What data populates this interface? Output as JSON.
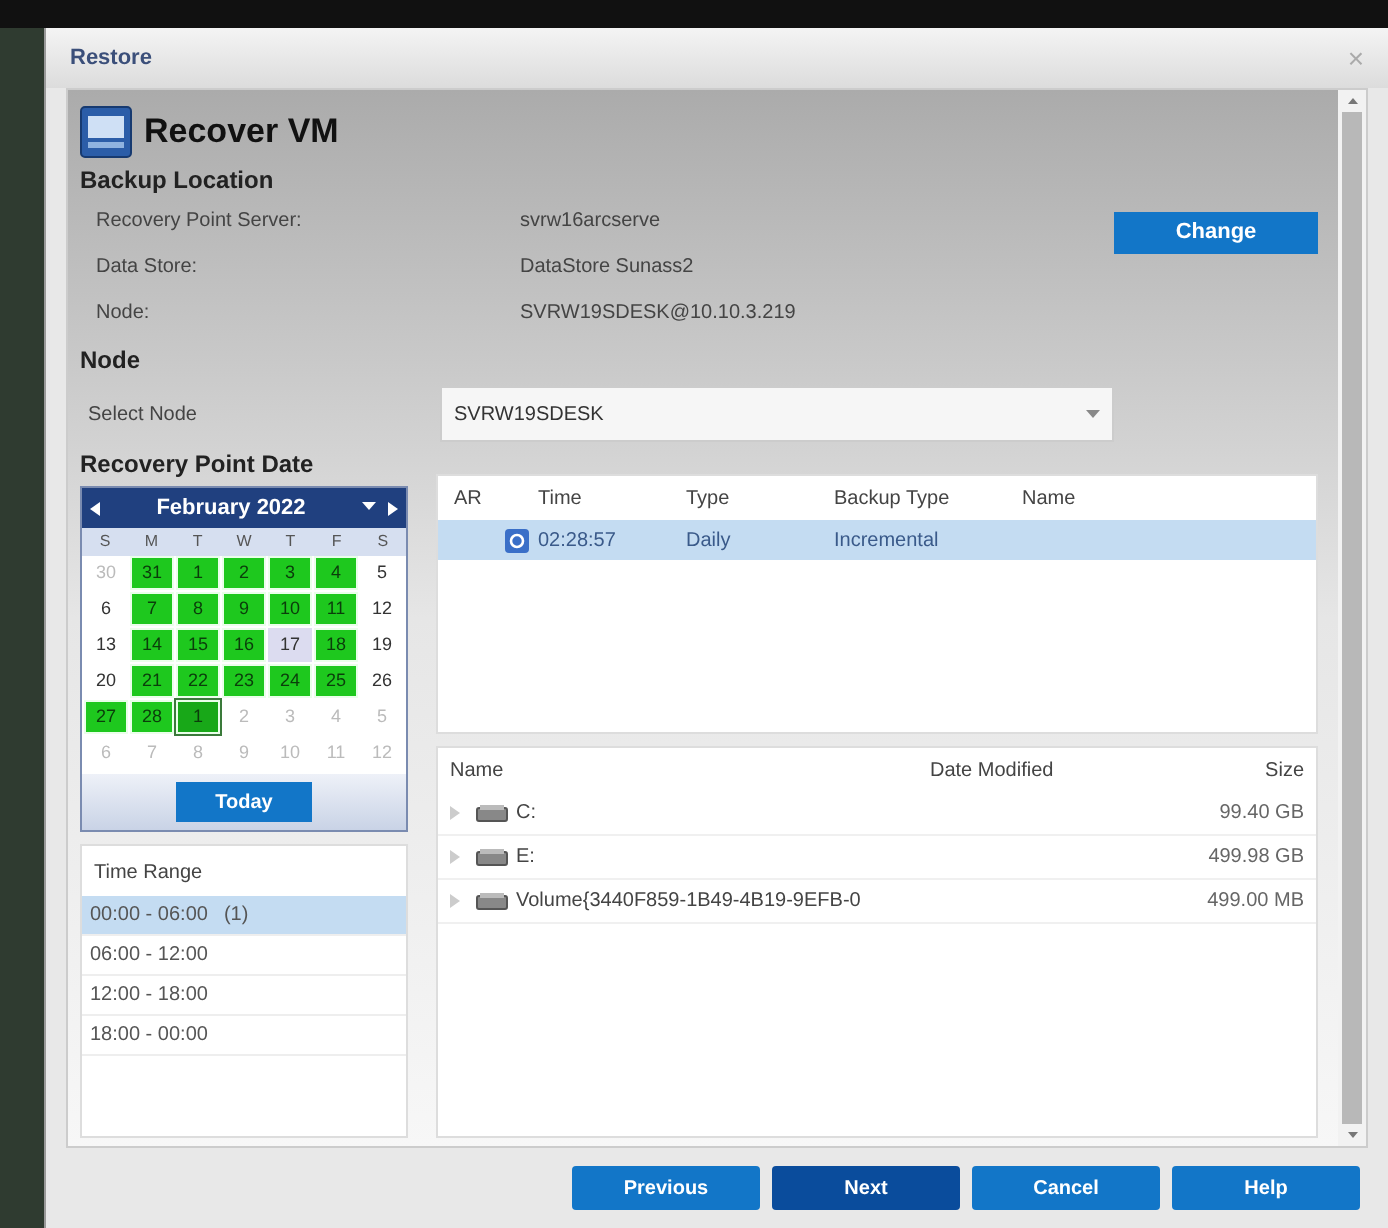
{
  "window": {
    "title": "Restore",
    "close": "×"
  },
  "header": {
    "title": "Recover VM"
  },
  "backup_location": {
    "heading": "Backup Location",
    "fields": [
      {
        "label": "Recovery Point Server:",
        "value": "svrw16arcserve"
      },
      {
        "label": "Data Store:",
        "value": "DataStore Sunass2"
      },
      {
        "label": "Node:",
        "value": "SVRW19SDESK@10.10.3.219"
      }
    ],
    "change_button": "Change"
  },
  "node": {
    "heading": "Node",
    "label": "Select Node",
    "value": "SVRW19SDESK"
  },
  "calendar": {
    "heading": "Recovery Point Date",
    "month": "February 2022",
    "weekdays": [
      "S",
      "M",
      "T",
      "W",
      "T",
      "F",
      "S"
    ],
    "weeks": [
      [
        {
          "label": "30",
          "kind": "other",
          "selected": false
        },
        {
          "label": "31",
          "kind": "backup",
          "selected": false
        },
        {
          "label": "1",
          "kind": "backup",
          "selected": false
        },
        {
          "label": "2",
          "kind": "backup",
          "selected": false
        },
        {
          "label": "3",
          "kind": "backup",
          "selected": false
        },
        {
          "label": "4",
          "kind": "backup",
          "selected": false
        },
        {
          "label": "5",
          "kind": "plain",
          "selected": false
        }
      ],
      [
        {
          "label": "6",
          "kind": "plain",
          "selected": false
        },
        {
          "label": "7",
          "kind": "backup",
          "selected": false
        },
        {
          "label": "8",
          "kind": "backup",
          "selected": false
        },
        {
          "label": "9",
          "kind": "backup",
          "selected": false
        },
        {
          "label": "10",
          "kind": "backup",
          "selected": false
        },
        {
          "label": "11",
          "kind": "backup",
          "selected": false
        },
        {
          "label": "12",
          "kind": "plain",
          "selected": false
        }
      ],
      [
        {
          "label": "13",
          "kind": "plain",
          "selected": false
        },
        {
          "label": "14",
          "kind": "backup",
          "selected": false
        },
        {
          "label": "15",
          "kind": "backup",
          "selected": false
        },
        {
          "label": "16",
          "kind": "backup",
          "selected": false
        },
        {
          "label": "17",
          "kind": "today",
          "selected": false
        },
        {
          "label": "18",
          "kind": "backup",
          "selected": false
        },
        {
          "label": "19",
          "kind": "plain",
          "selected": false
        }
      ],
      [
        {
          "label": "20",
          "kind": "plain",
          "selected": false
        },
        {
          "label": "21",
          "kind": "backup",
          "selected": false
        },
        {
          "label": "22",
          "kind": "backup",
          "selected": false
        },
        {
          "label": "23",
          "kind": "backup",
          "selected": false
        },
        {
          "label": "24",
          "kind": "backup",
          "selected": false
        },
        {
          "label": "25",
          "kind": "backup",
          "selected": false
        },
        {
          "label": "26",
          "kind": "plain",
          "selected": false
        }
      ],
      [
        {
          "label": "27",
          "kind": "backup",
          "selected": false
        },
        {
          "label": "28",
          "kind": "backup",
          "selected": false
        },
        {
          "label": "1",
          "kind": "backup",
          "selected": true
        },
        {
          "label": "2",
          "kind": "other",
          "selected": false
        },
        {
          "label": "3",
          "kind": "other",
          "selected": false
        },
        {
          "label": "4",
          "kind": "other",
          "selected": false
        },
        {
          "label": "5",
          "kind": "other",
          "selected": false
        }
      ],
      [
        {
          "label": "6",
          "kind": "other",
          "selected": false
        },
        {
          "label": "7",
          "kind": "other",
          "selected": false
        },
        {
          "label": "8",
          "kind": "other",
          "selected": false
        },
        {
          "label": "9",
          "kind": "other",
          "selected": false
        },
        {
          "label": "10",
          "kind": "other",
          "selected": false
        },
        {
          "label": "11",
          "kind": "other",
          "selected": false
        },
        {
          "label": "12",
          "kind": "other",
          "selected": false
        }
      ]
    ],
    "today_button": "Today"
  },
  "time_range": {
    "heading": "Time Range",
    "items": [
      {
        "label": "00:00 - 06:00",
        "count": "(1)",
        "selected": true
      },
      {
        "label": "06:00 - 12:00",
        "selected": false
      },
      {
        "label": "12:00 - 18:00",
        "selected": false
      },
      {
        "label": "18:00 - 00:00",
        "selected": false
      }
    ]
  },
  "recovery_points": {
    "columns": [
      "AR",
      "Time",
      "Type",
      "Backup Type",
      "Name"
    ],
    "rows": [
      {
        "time": "02:28:57",
        "type": "Daily",
        "backup_type": "Incremental",
        "selected": true
      }
    ]
  },
  "files": {
    "columns": [
      "Name",
      "Date Modified",
      "Size"
    ],
    "rows": [
      {
        "name": "C:",
        "size": "99.40 GB"
      },
      {
        "name": "E:",
        "size": "499.98 GB"
      },
      {
        "name": "Volume{3440F859-1B49-4B19-9EFB-0",
        "size": "499.00 MB"
      }
    ]
  },
  "buttons": [
    {
      "label": "Previous",
      "selected": false
    },
    {
      "label": "Next",
      "selected": true
    },
    {
      "label": "Cancel",
      "selected": false
    },
    {
      "label": "Help",
      "selected": false
    }
  ]
}
